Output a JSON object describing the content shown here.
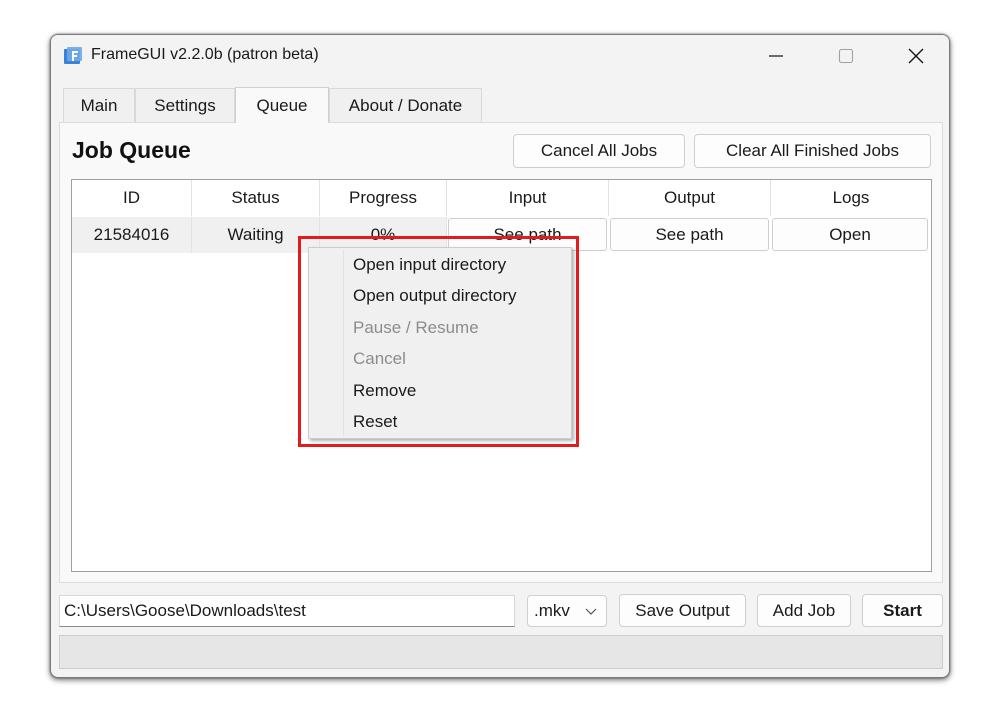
{
  "window": {
    "title": "FrameGUI v2.2.0b (patron beta)",
    "app_icon": "framegui-app-icon",
    "controls": [
      "minimize-icon",
      "maximize-icon",
      "close-icon"
    ]
  },
  "tabs": [
    {
      "label": "Main",
      "active": false
    },
    {
      "label": "Settings",
      "active": false
    },
    {
      "label": "Queue",
      "active": true
    },
    {
      "label": "About / Donate",
      "active": false
    }
  ],
  "queue": {
    "heading": "Job Queue",
    "cancel_all_label": "Cancel All Jobs",
    "clear_finished_label": "Clear All Finished Jobs",
    "columns": [
      "ID",
      "Status",
      "Progress",
      "Input",
      "Output",
      "Logs"
    ],
    "rows": [
      {
        "id": "21584016",
        "status": "Waiting",
        "progress": "0%",
        "input_button": "See path",
        "output_button": "See path",
        "logs_button": "Open"
      }
    ]
  },
  "context_menu": {
    "items": [
      {
        "label": "Open input directory",
        "enabled": true
      },
      {
        "label": "Open output directory",
        "enabled": true
      },
      {
        "label": "Pause / Resume",
        "enabled": false
      },
      {
        "label": "Cancel",
        "enabled": false
      },
      {
        "label": "Remove",
        "enabled": true
      },
      {
        "label": "Reset",
        "enabled": true
      }
    ],
    "highlight_color": "#e21b1b"
  },
  "bottom": {
    "output_path": "C:\\Users\\Goose\\Downloads\\test",
    "extension": ".mkv",
    "save_output_label": "Save Output",
    "add_job_label": "Add Job",
    "start_label": "Start"
  }
}
